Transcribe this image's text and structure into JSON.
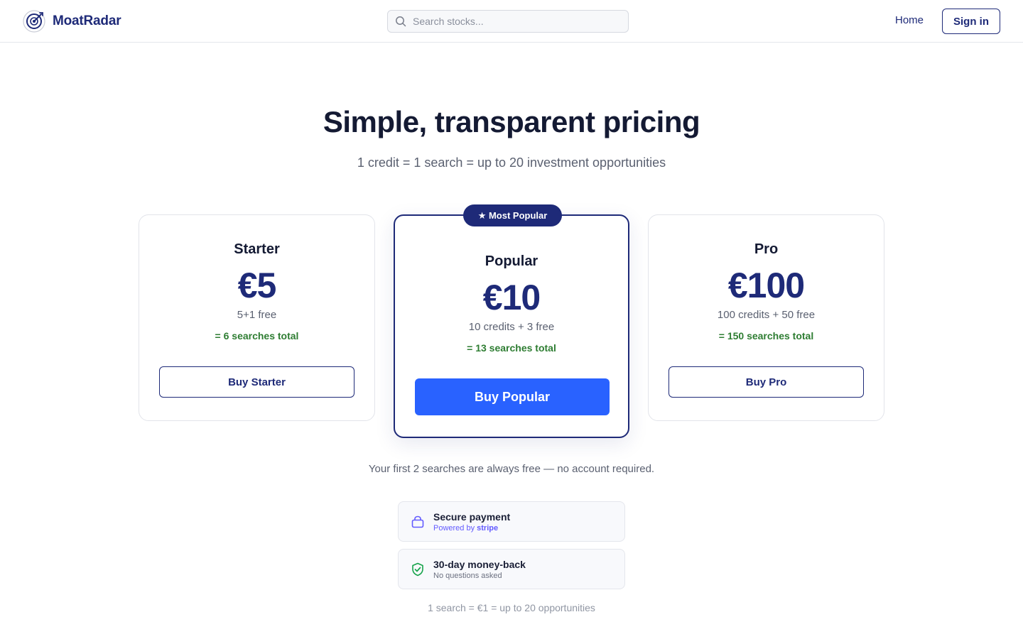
{
  "header": {
    "brand": "MoatRadar",
    "search_placeholder": "Search stocks...",
    "nav_home": "Home",
    "sign_in": "Sign in"
  },
  "hero": {
    "title": "Simple, transparent pricing",
    "subtitle": "1 credit = 1 search = up to 20 investment opportunities"
  },
  "plans": [
    {
      "name": "Starter",
      "price": "€5",
      "credits": "5+1 free",
      "total": "= 6 searches total",
      "button": "Buy Starter"
    },
    {
      "badge": "★ Most Popular",
      "name": "Popular",
      "price": "€10",
      "credits": "10 credits + 3 free",
      "total": "= 13 searches total",
      "button": "Buy Popular"
    },
    {
      "name": "Pro",
      "price": "€100",
      "credits": "100 credits + 50 free",
      "total": "= 150 searches total",
      "button": "Buy Pro"
    }
  ],
  "free_note": "Your first 2 searches are always free — no account required.",
  "trust": {
    "secure": {
      "title": "Secure payment",
      "sub_prefix": "Powered by",
      "sub_brand": "stripe",
      "icon": "lock-icon"
    },
    "money_back": {
      "title": "30-day money-back",
      "sub": "No questions asked",
      "icon": "shield-check-icon"
    }
  },
  "footnote": "1 search = €1 = up to 20 opportunities",
  "colors": {
    "brand_navy": "#1e2a78",
    "primary_blue": "#2962ff",
    "success_green": "#2e7d32",
    "stripe_purple": "#635bff"
  }
}
